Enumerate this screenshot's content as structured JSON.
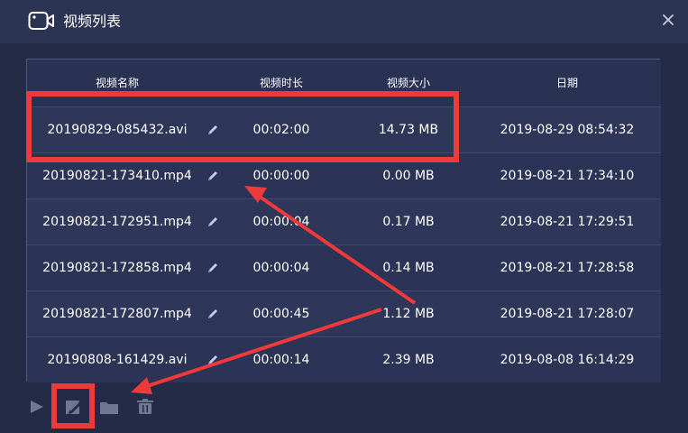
{
  "window": {
    "title": "视频列表",
    "title_icon": "video-camera-icon",
    "close_icon": "close-icon"
  },
  "table": {
    "headers": {
      "name": "视频名称",
      "duration": "视频时长",
      "size": "视频大小",
      "date": "日期"
    },
    "rows": [
      {
        "name": "20190829-085432.avi",
        "duration": "00:02:00",
        "size": "14.73 MB",
        "date": "2019-08-29 08:54:32"
      },
      {
        "name": "20190821-173410.mp4",
        "duration": "00:00:00",
        "size": "0.00 MB",
        "date": "2019-08-21 17:34:10"
      },
      {
        "name": "20190821-172951.mp4",
        "duration": "00:00:04",
        "size": "0.17 MB",
        "date": "2019-08-21 17:29:51"
      },
      {
        "name": "20190821-172858.mp4",
        "duration": "00:00:04",
        "size": "0.14 MB",
        "date": "2019-08-21 17:28:58"
      },
      {
        "name": "20190821-172807.mp4",
        "duration": "00:00:45",
        "size": "1.12 MB",
        "date": "2019-08-21 17:28:07"
      },
      {
        "name": "20190808-161429.avi",
        "duration": "00:00:14",
        "size": "2.39 MB",
        "date": "2019-08-08 16:14:29"
      }
    ]
  },
  "toolbar": {
    "icons": [
      "play-icon",
      "edit-icon",
      "folder-icon",
      "trash-icon"
    ]
  },
  "colors": {
    "background": "#242b47",
    "titlebar": "#2c3454",
    "table_border": "#505980",
    "annotation": "#ee3a3a",
    "icon_muted": "#6f7794"
  }
}
